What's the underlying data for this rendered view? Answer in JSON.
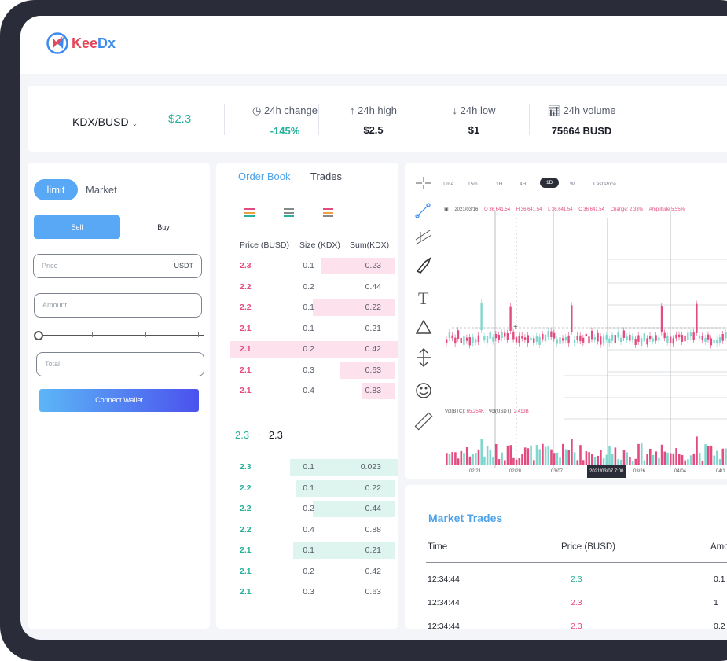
{
  "brand": {
    "logo_k": "Kee",
    "logo_d": "Dx"
  },
  "ticker": {
    "pair": "KDX/BUSD",
    "price": "$2.3",
    "stats": [
      {
        "label": "24h change",
        "value": "-145%",
        "icon": "clock-icon"
      },
      {
        "label": "24h high",
        "value": "$2.5",
        "icon": "arrow-up-icon"
      },
      {
        "label": "24h low",
        "value": "$1",
        "icon": "arrow-down-icon"
      },
      {
        "label": "24h volume",
        "value": "75664 BUSD",
        "icon": "bar-chart-icon"
      }
    ]
  },
  "trade_form": {
    "tab_limit": "limit",
    "tab_market": "Market",
    "sell": "Sell",
    "buy": "Buy",
    "price_placeholder": "Price",
    "price_unit": "USDT",
    "amount_placeholder": "Amount",
    "total_placeholder": "Total",
    "connect": "Connect Wallet"
  },
  "order_book": {
    "tab_book": "Order Book",
    "tab_trades": "Trades",
    "headers": [
      "Price (BUSD)",
      "Size (KDX)",
      "Sum(KDX)"
    ],
    "asks": [
      {
        "price": "2.3",
        "size": "0.1",
        "sum": "0.23",
        "depth": 0.45
      },
      {
        "price": "2.2",
        "size": "0.2",
        "sum": "0.44",
        "depth": 0.0
      },
      {
        "price": "2.2",
        "size": "0.1",
        "sum": "0.22",
        "depth": 0.5
      },
      {
        "price": "2.1",
        "size": "0.1",
        "sum": "0.21",
        "depth": 0.0
      },
      {
        "price": "2.1",
        "size": "0.2",
        "sum": "0.42",
        "depth": 1.0
      },
      {
        "price": "2.1",
        "size": "0.3",
        "sum": "0.63",
        "depth": 0.34
      },
      {
        "price": "2.1",
        "size": "0.4",
        "sum": "0.83",
        "depth": 0.2
      }
    ],
    "mid_price": "2.3",
    "mid_arrow": "↑",
    "mid_last": "2.3",
    "bids": [
      {
        "price": "2.3",
        "size": "0.1",
        "sum": "0.023",
        "depth": 1.0
      },
      {
        "price": "2.2",
        "size": "0.1",
        "sum": "0.22",
        "depth": 0.6
      },
      {
        "price": "2.2",
        "size": "0.2",
        "sum": "0.44",
        "depth": 0.5
      },
      {
        "price": "2.2",
        "size": "0.4",
        "sum": "0.88",
        "depth": 0.0
      },
      {
        "price": "2.1",
        "size": "0.1",
        "sum": "0.21",
        "depth": 0.62
      },
      {
        "price": "2.1",
        "size": "0.2",
        "sum": "0.42",
        "depth": 0.0
      },
      {
        "price": "2.1",
        "size": "0.3",
        "sum": "0.63",
        "depth": 0.0
      }
    ]
  },
  "chart": {
    "timeframes": [
      "Time",
      "15m",
      "1H",
      "4H",
      "1D",
      "W",
      "Last Price"
    ],
    "active_timeframe": "1D",
    "date": "2021/03/16",
    "open": "O 36,641.54",
    "high": "H 36,641.54",
    "low": "L 36,641.54",
    "close": "C 36,641.54",
    "change": "Change: 2.33%",
    "amplitude": "Amplitude 5.55%",
    "vol_btc_label": "Vol(BTC):",
    "vol_btc": "65,254K",
    "vol_usdt_label": "Vol(USDT):",
    "vol_usdt": "2.413B",
    "x_labels": [
      "02/21",
      "02/28",
      "03/07",
      "2021/03/07 7:00",
      "03/26",
      "04/04",
      "04/1"
    ]
  },
  "market_trades": {
    "title": "Market Trades",
    "headers": [
      "Time",
      "Price (BUSD)",
      "Amo"
    ],
    "rows": [
      {
        "time": "12:34:44",
        "price": "2.3",
        "amount": "0.1",
        "color": "#27b09b"
      },
      {
        "time": "12:34:44",
        "price": "2.3",
        "amount": "1",
        "color": "#e34c80"
      },
      {
        "time": "12:34:44",
        "price": "2.3",
        "amount": "0.2",
        "color": "#e34c80"
      }
    ]
  },
  "colors": {
    "accent": "#58a8f5",
    "up": "#27b09b",
    "down": "#e34c80",
    "ask_bg": "#fde1ec",
    "bid_bg": "#def4ee"
  }
}
